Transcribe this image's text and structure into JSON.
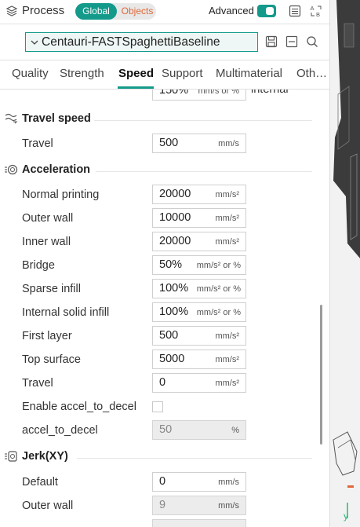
{
  "header": {
    "title": "Process",
    "seg_global": "Global",
    "seg_objects": "Objects",
    "advanced_label": "Advanced",
    "advanced_on": true,
    "accent_color": "#149a8b",
    "objects_color": "#e0683a"
  },
  "preset": {
    "name": "Centauri-FASTSpaghettiBaseline"
  },
  "tabs": [
    {
      "label": "Quality",
      "active": false
    },
    {
      "label": "Strength",
      "active": false
    },
    {
      "label": "Speed",
      "active": true
    },
    {
      "label": "Support",
      "active": false
    },
    {
      "label": "Multimaterial",
      "active": false
    },
    {
      "label": "Oth…",
      "active": false
    }
  ],
  "top_partial": {
    "value": "150%",
    "unit": "mm/s or %",
    "label": "internal"
  },
  "travel_speed": {
    "title": "Travel speed",
    "rows": [
      {
        "label": "Travel",
        "value": "500",
        "unit": "mm/s"
      }
    ]
  },
  "acceleration": {
    "title": "Acceleration",
    "rows": [
      {
        "label": "Normal printing",
        "value": "20000",
        "unit": "mm/s²"
      },
      {
        "label": "Outer wall",
        "value": "10000",
        "unit": "mm/s²"
      },
      {
        "label": "Inner wall",
        "value": "20000",
        "unit": "mm/s²"
      },
      {
        "label": "Bridge",
        "value": "50%",
        "unit": "mm/s² or %"
      },
      {
        "label": "Sparse infill",
        "value": "100%",
        "unit": "mm/s² or %"
      },
      {
        "label": "Internal solid infill",
        "value": "100%",
        "unit": "mm/s² or %"
      },
      {
        "label": "First layer",
        "value": "500",
        "unit": "mm/s²"
      },
      {
        "label": "Top surface",
        "value": "5000",
        "unit": "mm/s²"
      },
      {
        "label": "Travel",
        "value": "0",
        "unit": "mm/s²"
      }
    ],
    "enable_accel_label": "Enable accel_to_decel",
    "enable_accel_checked": false,
    "accel_to_decel_label": "accel_to_decel",
    "accel_to_decel_value": "50",
    "accel_to_decel_unit": "%"
  },
  "jerk": {
    "title": "Jerk(XY)",
    "rows": [
      {
        "label": "Default",
        "value": "0",
        "unit": "mm/s",
        "disabled": false
      },
      {
        "label": "Outer wall",
        "value": "9",
        "unit": "mm/s",
        "disabled": true
      }
    ]
  },
  "viewport": {
    "axis_label": "y"
  }
}
